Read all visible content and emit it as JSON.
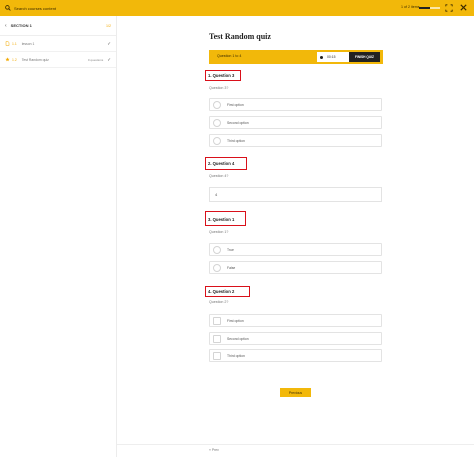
{
  "topbar": {
    "search_label": "Search courses content",
    "progress_text": "1 of 2 items",
    "progress_fraction": 0.5,
    "search_icon": "search-icon",
    "fullscreen_icon": "fullscreen-icon",
    "close_icon": "close-icon",
    "accent": "#f2b80a"
  },
  "sidebar": {
    "section_title": "SECTION 1",
    "section_count": "1/2",
    "lessons": [
      {
        "num": "1.1",
        "label": "lesson 1",
        "tag": "",
        "icon": "document-icon"
      },
      {
        "num": "1.2",
        "label": "Test Random quiz",
        "tag": "0 questions",
        "icon": "star-icon"
      }
    ]
  },
  "main": {
    "title": "Test Random quiz",
    "status": {
      "label": "Question 1 to 4",
      "timer": "00:15",
      "finish": "FINISH QUIZ"
    },
    "questions": [
      {
        "heading": "1. Question 3",
        "text": "Question 3?",
        "options": [
          "First option",
          "Second option",
          "Third option"
        ]
      },
      {
        "heading": "2. Question 4",
        "text": "Question 4?",
        "input_value": "4"
      },
      {
        "heading": "3. Question 1",
        "text": "Question 1?",
        "options": [
          "True",
          "False"
        ]
      },
      {
        "heading": "4. Question 2",
        "text": "Question 2?",
        "options": [
          "First option",
          "Second option",
          "Third option"
        ]
      }
    ],
    "review_button": "Previous",
    "footer_prev": "« Prev"
  }
}
